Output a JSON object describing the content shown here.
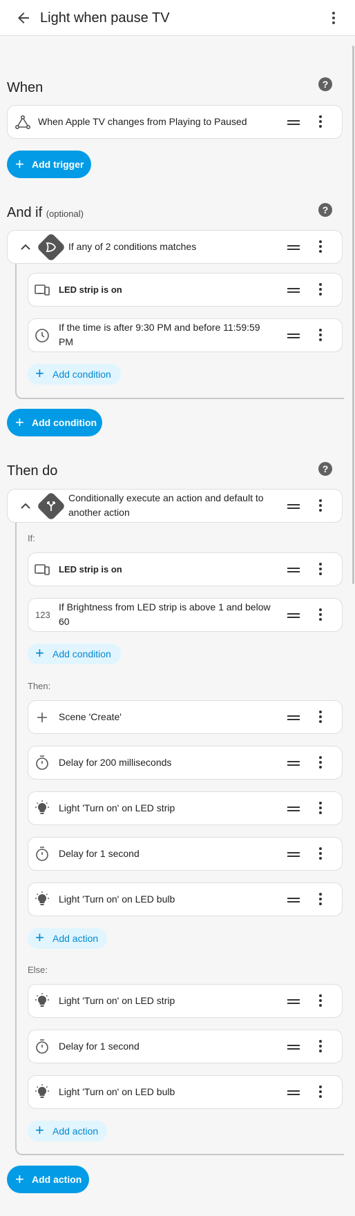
{
  "header": {
    "title": "Light when pause TV"
  },
  "sections": {
    "when": "When",
    "and_if": "And if",
    "and_if_optional": "(optional)",
    "then_do": "Then do"
  },
  "help_glyph": "?",
  "trigger": {
    "text": "When Apple TV  changes from Playing  to Paused"
  },
  "buttons": {
    "add_trigger": "Add trigger",
    "add_condition": "Add condition",
    "add_action": "Add action"
  },
  "conditions": {
    "group": "If any of 2 conditions matches",
    "items": [
      "LED strip is on",
      "If the time is after 9:30 PM and before 11:59:59 PM"
    ]
  },
  "choose": {
    "title": "Conditionally execute an action and default to another action",
    "if_label": "If:",
    "then_label": "Then:",
    "else_label": "Else:",
    "if_items": [
      "LED strip is on",
      "If Brightness from  LED strip  is above 1 and below 60"
    ],
    "then_items": [
      "Scene 'Create'",
      "Delay for 200 milliseconds",
      "Light 'Turn on' on LED strip",
      "Delay for 1 second",
      "Light 'Turn on' on LED bulb"
    ],
    "else_items": [
      "Light 'Turn on' on LED strip",
      "Delay for 1 second",
      "Light 'Turn on' on LED bulb"
    ]
  },
  "icons": {
    "number_glyph": "123",
    "plus_glyph": "+"
  },
  "colors": {
    "accent": "#039be5",
    "accent_light": "#e1f5fe",
    "accent_text": "#0288d1"
  }
}
